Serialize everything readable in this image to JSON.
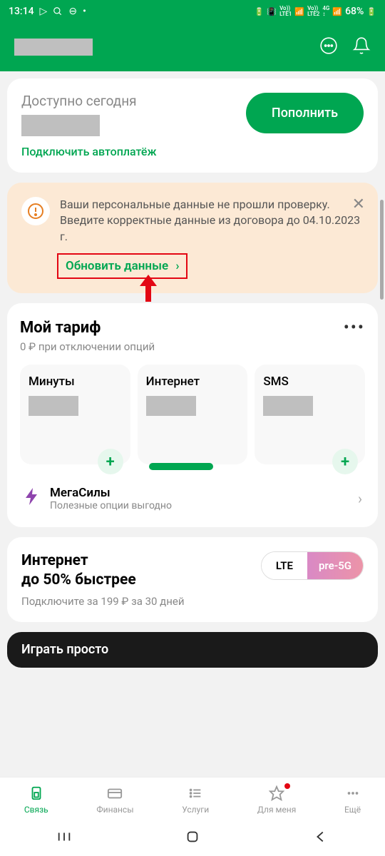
{
  "statusBar": {
    "time": "13:14",
    "battery": "68%",
    "indicators": {
      "lte1": "Vo))\nLTE1",
      "lte2": "Vo))\nLTE2",
      "4g": "4G"
    }
  },
  "balance": {
    "label": "Доступно сегодня",
    "topupButton": "Пополнить",
    "autopayLink": "Подключить автоплатёж"
  },
  "warning": {
    "text": "Ваши персональные данные не прошли проверку. Введите корректные данные из договора до 04.10.2023 г.",
    "updateLink": "Обновить данные",
    "chevron": "›"
  },
  "tariff": {
    "title": "Мой тариф",
    "subtitle": "0 ₽ при отключении опций",
    "items": [
      {
        "title": "Минуты"
      },
      {
        "title": "Интернет"
      },
      {
        "title": "SMS"
      }
    ],
    "megasily": {
      "title": "МегаСилы",
      "subtitle": "Полезные опции выгодно"
    }
  },
  "internet": {
    "title1": "Интернет",
    "title2": "до 50% быстрее",
    "subtitle": "Подключите за 199 ₽ за 30 дней",
    "lte": "LTE",
    "pre5g": "pre-5G"
  },
  "promo": {
    "text": "Играть просто"
  },
  "bottomNav": {
    "items": [
      {
        "label": "Связь",
        "active": true
      },
      {
        "label": "Финансы"
      },
      {
        "label": "Услуги"
      },
      {
        "label": "Для меня",
        "dot": true
      },
      {
        "label": "Ещё"
      }
    ]
  }
}
